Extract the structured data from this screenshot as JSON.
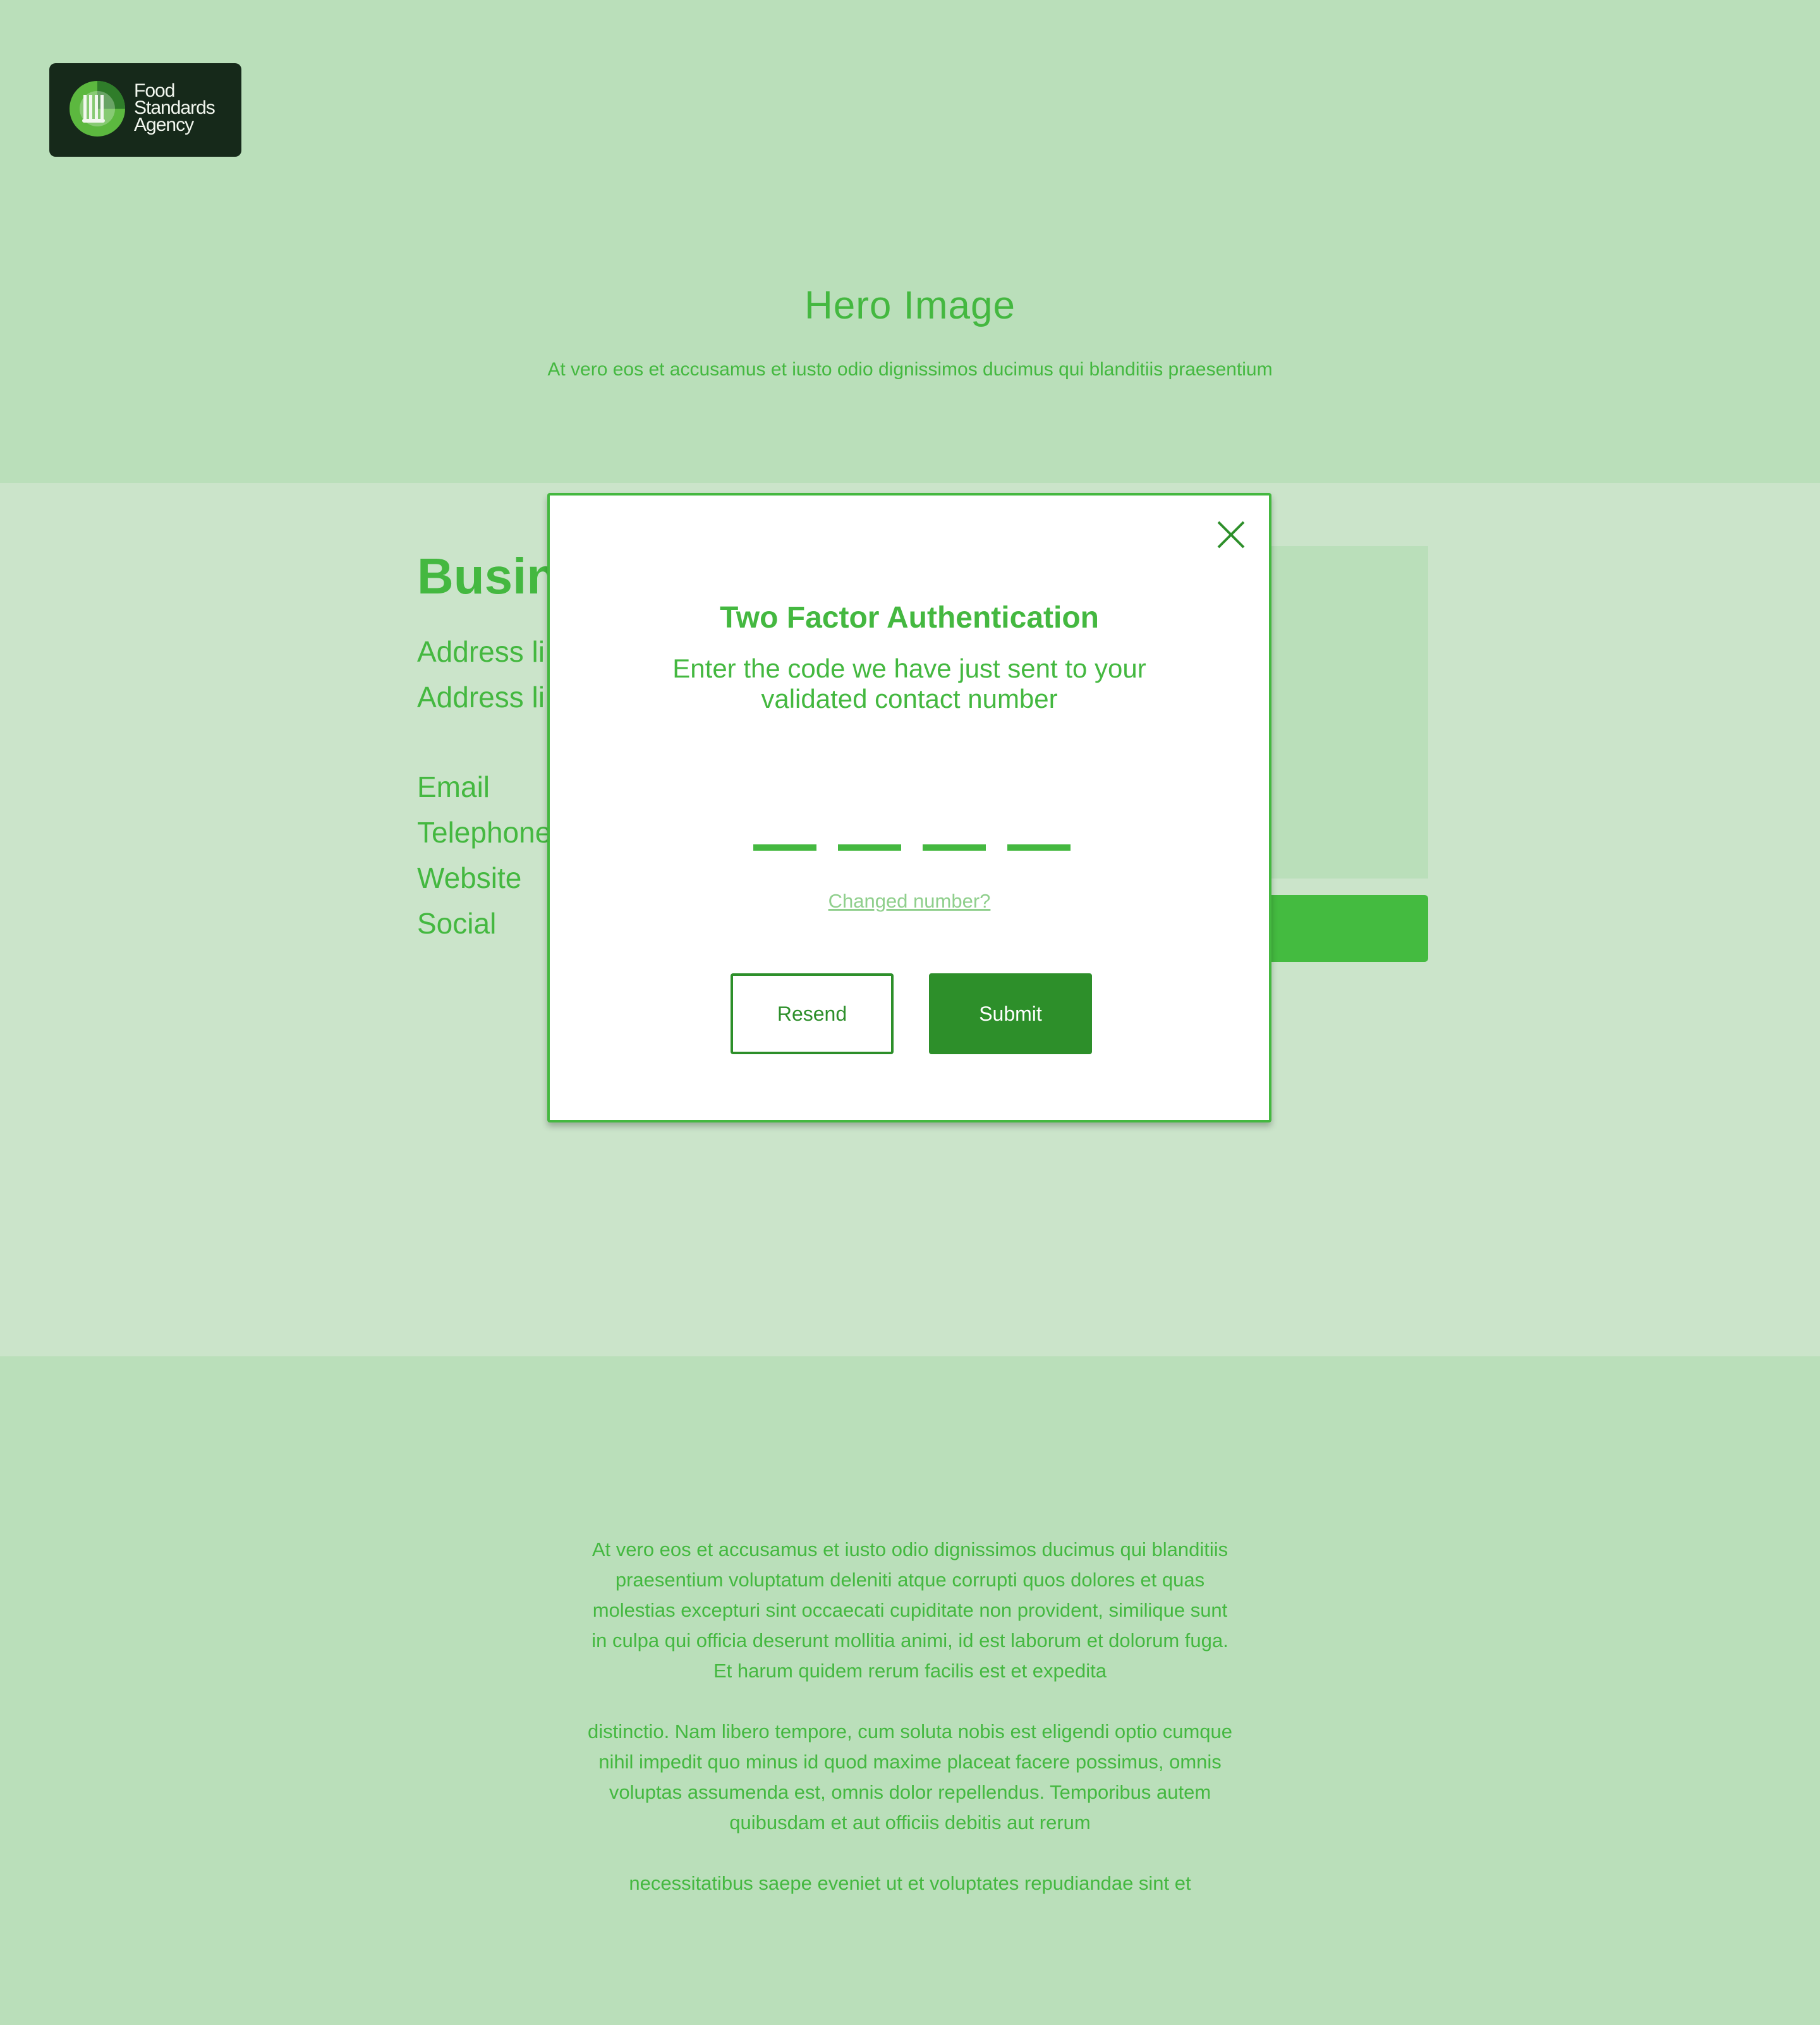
{
  "logo": {
    "lines": [
      "Food",
      "Standards",
      "Agency"
    ]
  },
  "hero": {
    "title": "Hero Image",
    "subtitle": "At vero eos et accusamus et iusto odio dignissimos ducimus qui blanditiis praesentium"
  },
  "business": {
    "title": "Busin",
    "address_line_1": "Address li",
    "address_line_2": "Address li",
    "contacts": [
      "Email",
      "Telephone",
      "Website",
      "Social"
    ]
  },
  "modal": {
    "title": "Two Factor Authentication",
    "subtitle_line_1": "Enter the code we have just sent to your",
    "subtitle_line_2": "validated contact number",
    "code_slots": 4,
    "changed_number_link": "Changed number?",
    "resend_label": "Resend",
    "submit_label": "Submit",
    "close_icon": "close-icon"
  },
  "footer": {
    "paragraphs": [
      [
        "At vero eos et accusamus et iusto odio dignissimos ducimus qui blanditiis",
        "praesentium voluptatum deleniti atque corrupti quos dolores et quas",
        "molestias excepturi sint occaecati cupiditate non provident, similique sunt",
        "in culpa qui officia deserunt mollitia animi, id est laborum et dolorum fuga.",
        "Et harum quidem rerum facilis est et expedita"
      ],
      [
        "distinctio. Nam libero tempore, cum soluta nobis est eligendi optio cumque",
        "nihil impedit quo minus id quod maxime placeat facere possimus, omnis",
        "voluptas assumenda est, omnis dolor repellendus. Temporibus autem",
        "quibusdam et aut officiis debitis aut rerum"
      ],
      [
        "necessitatibus saepe eveniet ut et voluptates repudiandae sint et"
      ]
    ]
  },
  "colors": {
    "accent_green": "#44b840",
    "dark_green": "#2d8f2a",
    "hero_bg": "#badfba",
    "page_bg": "#cbe4ca",
    "logo_bg": "#16291a"
  }
}
